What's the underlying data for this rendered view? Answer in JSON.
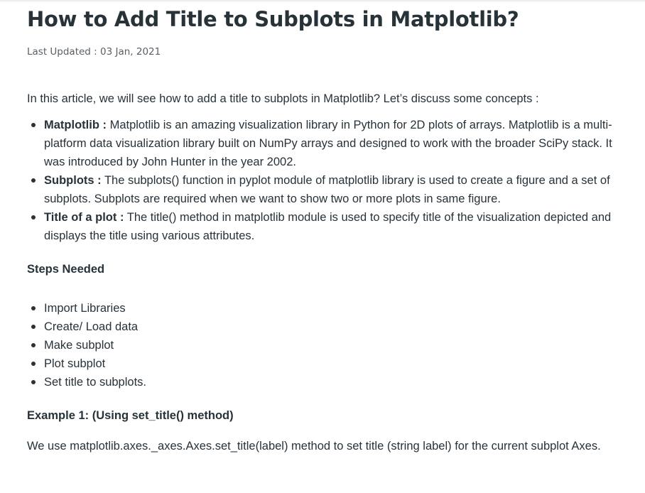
{
  "article": {
    "title": "How to Add Title to Subplots in Matplotlib?",
    "last_updated": "Last Updated : 03 Jan, 2021",
    "intro": "In this article, we will see how to add a title to subplots in Matplotlib? Let’s discuss some concepts :",
    "concepts": [
      {
        "term": "Matplotlib :",
        "text": " Matplotlib is an amazing visualization library in Python for 2D plots of arrays. Matplotlib is a multi-platform data visualization library built on NumPy arrays and designed to work with the broader SciPy stack. It was introduced by John Hunter in the year 2002."
      },
      {
        "term": "Subplots :",
        "text": " The subplots() function in pyplot module of matplotlib library is used to create a figure and a set of subplots. Subplots are required when we want to show two or more plots in same figure."
      },
      {
        "term": "Title of a plot :",
        "text": " The title() method in matplotlib module is used to specify title of the visualization depicted and displays the title using various attributes."
      }
    ],
    "steps_heading": "Steps Needed",
    "steps": [
      "Import Libraries",
      "Create/ Load data",
      "Make subplot",
      "Plot subplot",
      "Set title to subplots."
    ],
    "example_heading": "Example 1: (Using set_title() method)",
    "example_text": "We use matplotlib.axes._axes.Axes.set_title(label) method to set title (string label) for the current subplot Axes."
  }
}
